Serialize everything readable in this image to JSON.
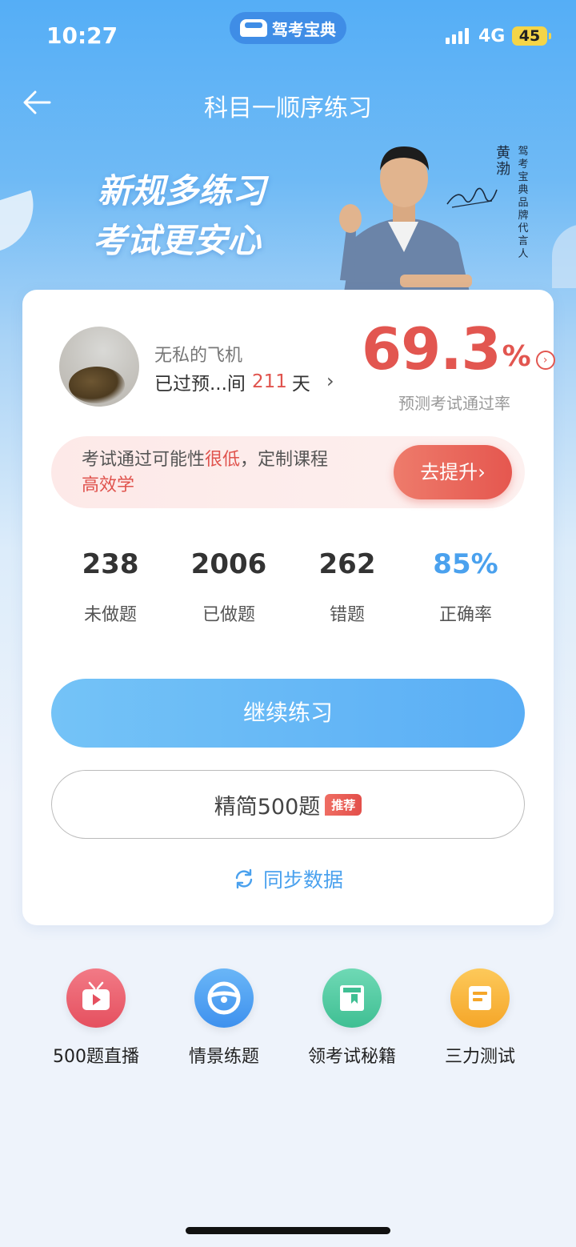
{
  "status": {
    "time": "10:27",
    "app_pill": "驾考宝典",
    "network": "4G",
    "battery": "45"
  },
  "nav": {
    "title": "科目一顺序练习"
  },
  "banner": {
    "slogan_line1": "新规多练习",
    "slogan_line2": "考试更安心",
    "spokesperson_name": "黄渤",
    "spokesperson_role": "驾考宝典品牌代言人"
  },
  "profile": {
    "username": "无私的飞机",
    "days_prefix": "已过预...间",
    "days_value": "211",
    "days_unit": "天"
  },
  "pass_rate": {
    "value": "69.3",
    "unit": "%",
    "label": "预测考试通过率"
  },
  "promo": {
    "text_before": "考试通过可能性",
    "text_highlight": "很低",
    "text_after": "，定制课程",
    "text_line2": "高效学",
    "button_label": "去提升"
  },
  "stats": [
    {
      "value": "238",
      "label": "未做题"
    },
    {
      "value": "2006",
      "label": "已做题"
    },
    {
      "value": "262",
      "label": "错题"
    },
    {
      "value": "85%",
      "label": "正确率"
    }
  ],
  "actions": {
    "continue_label": "继续练习",
    "jianjing_label": "精简500题",
    "jianjing_badge": "推荐",
    "sync_label": "同步数据"
  },
  "shortcuts": [
    {
      "label": "500题直播",
      "icon": "tv-play-icon"
    },
    {
      "label": "情景练题",
      "icon": "steering-wheel-icon"
    },
    {
      "label": "领考试秘籍",
      "icon": "book-icon"
    },
    {
      "label": "三力测试",
      "icon": "document-icon"
    }
  ],
  "colors": {
    "accent_blue": "#4aa1ee",
    "alert_red": "#e25650",
    "header_blue": "#55aef6"
  }
}
